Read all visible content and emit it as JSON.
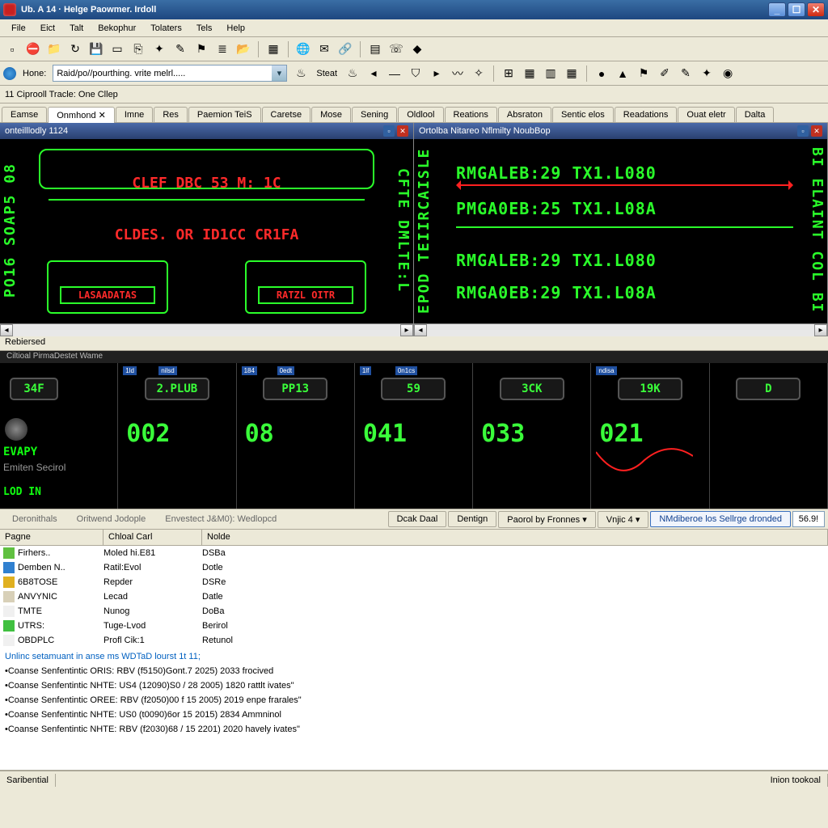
{
  "window": {
    "title": "Ub. A 14 · Helge Paowmer. Irdoll"
  },
  "menu": [
    "File",
    "Eict",
    "Talt",
    "Bekophur",
    "Tolaters",
    "Tels",
    "Help"
  ],
  "toolbar1_icons": [
    "file",
    "stop",
    "folder",
    "refresh",
    "disk",
    "rect",
    "copy",
    "wand",
    "pin",
    "flag",
    "stack",
    "open",
    "|",
    "cube",
    "|",
    "globe",
    "mail",
    "link",
    "|",
    "page",
    "phone",
    "diamond"
  ],
  "addr": {
    "home_label": "Hone:",
    "value": "Raid/po//pourthing. vrite melrl.....",
    "start_label": "Steat",
    "icons": [
      "fire",
      "back",
      "line",
      "shield",
      "fwd",
      "wave",
      "star",
      "|",
      "win",
      "grid",
      "cols",
      "cal",
      "|",
      "dot",
      "warn",
      "flag",
      "brush",
      "pin",
      "wand",
      "globe2"
    ]
  },
  "info_row": "11 Ciprooll   Tracle: One Cllep",
  "tabs": [
    {
      "label": "Eamse"
    },
    {
      "label": "Onmhond ✕",
      "active": true
    },
    {
      "label": "Imne"
    },
    {
      "label": "Res"
    },
    {
      "label": "Paemion TeiS"
    },
    {
      "label": "Caretse"
    },
    {
      "label": "Mose"
    },
    {
      "label": "Sening"
    },
    {
      "label": "Oldlool"
    },
    {
      "label": "Reations"
    },
    {
      "label": "Absraton"
    },
    {
      "label": "Sentic elos"
    },
    {
      "label": "Readations"
    },
    {
      "label": "Ouat eletr"
    },
    {
      "label": "Dalta"
    }
  ],
  "pane_left": {
    "title": "onteilllodly 1124",
    "side_left": "PO16 SOAP5 08",
    "side_right": "CFTE DMLTE:L",
    "line1": "CLEF DBC 53  M: 1C",
    "line2": "CLDES.  OR ID1CC  CR1FA",
    "dev1": "LASAADATAS",
    "dev2": "RATZL OITR"
  },
  "pane_right": {
    "title": "Ortolba Nitareo Nflmilty NoubBop",
    "side_left": "EPOD TEIIRCAISLE",
    "side_right": "BI ELAINT COL BI",
    "rows": [
      "RMGALEB:29 TX1.L080",
      "PMGA0EB:25 TX1.L08A",
      "RMGALEB:29 TX1.L080",
      "RMGA0EB:29 TX1.L08A"
    ]
  },
  "rel": {
    "header": "Rebiersed",
    "sub": "Ciltioal   PirmaDestet  Wame",
    "col0": {
      "chip": "34F",
      "evapy": "EVAPY",
      "sub": "Emiten Secirol",
      "login": "LOD IN"
    },
    "cols": [
      {
        "chip1": "1ld",
        "chip2": "nilsd",
        "btn": "2.PLUB",
        "big": "002"
      },
      {
        "chip1": "184",
        "chip2": "0edt",
        "btn": "PP13",
        "big": "08"
      },
      {
        "chip1": "1lf",
        "chip2": "0n1cs",
        "btn": "59",
        "big": "041"
      },
      {
        "chip1": "",
        "chip2": "",
        "btn": "3CK",
        "big": "033"
      },
      {
        "chip1": "ndisa",
        "chip2": "",
        "btn": "19K",
        "big": "021",
        "wave": true
      },
      {
        "chip1": "",
        "chip2": "",
        "btn": "D",
        "big": ""
      }
    ]
  },
  "actbar": {
    "labels": [
      "Deronithals",
      "Oritwend Jodople",
      "Envestect J&M0): Wedlopcd"
    ],
    "buttons": [
      "Dcak Daal",
      "Dentign"
    ],
    "dropdowns": [
      "Paorol by Fronnes ▾",
      "Vnjic 4 ▾"
    ],
    "info": "NMdiberoe los Sellrge dronded",
    "field": "56.9!"
  },
  "grid": {
    "headers": [
      "Pagne",
      "Chloal Carl",
      "Nolde"
    ],
    "rows": [
      {
        "icon": "#60c040",
        "name": "Firhers..",
        "c2": "Moled hi.E81",
        "c3": "DSBa"
      },
      {
        "icon": "#3080d0",
        "name": "Demben N..",
        "c2": "Ratil:Evol",
        "c3": "Dotle"
      },
      {
        "icon": "#e0b020",
        "name": "6B8TOSE",
        "c2": "Repder",
        "c3": "DSRe"
      },
      {
        "icon": "#d8d0b8",
        "name": "ANVYNIC",
        "c2": "Lecad",
        "c3": "Datle"
      },
      {
        "icon": "#f0f0f0",
        "name": "TMTE",
        "c2": "Nunog",
        "c3": "DoBa"
      },
      {
        "icon": "#40c040",
        "name": "UTRS:",
        "c2": "Tuge-Lvod",
        "c3": "Berirol"
      },
      {
        "icon": "#f0f0f0",
        "name": "OBDPLC",
        "c2": "Profl Cik:1",
        "c3": "Retunol"
      }
    ],
    "log_header": "Unlinc setamuant in anse ms WDTaD lourst 1t 11;",
    "log": [
      "•Coanse Senfentintic ORIS: RBV (f5150)Gont.7 2025)   2033 frocived",
      "•Coanse Senfentintic NHTE: US4 (12090)S0 / 28 2005)   1820 rattlt ivates\"",
      "•Coanse Senfentintic OREE: RBV (f2050)00 f 15 2005)   2019 enpe frarales\"",
      "•Coanse Senfentintic NHTE: US0 (t0090)6or 15 2015)   2834 Ammninol",
      "•Coanse Senfentintic NHTE: RBV (f2030)68 / 15 2201)   2020 havely ivates\""
    ]
  },
  "status": {
    "left": "Saribential",
    "right": "Inion tookoal"
  }
}
